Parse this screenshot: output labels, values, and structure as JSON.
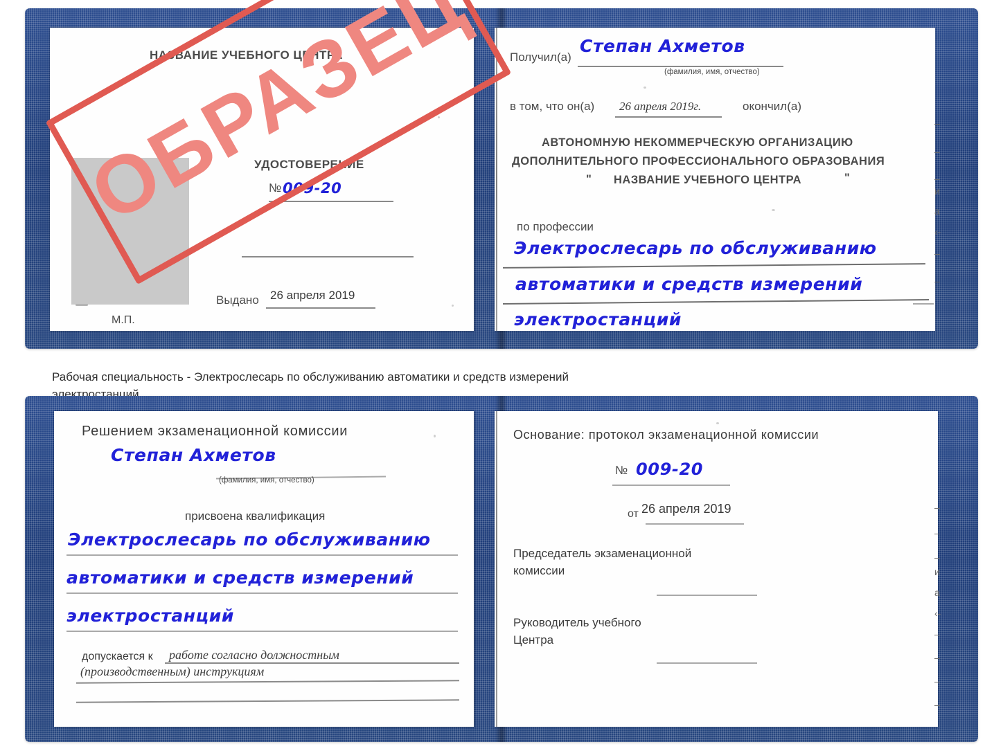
{
  "document": {
    "type": "certificate-scan",
    "colors": {
      "cover_blue": "#254489",
      "handwriting_blue": "#2121d8",
      "stamp_red": "#e05a52",
      "stamp_fill": "#ef8780",
      "print_gray": "#4b4b4b",
      "photo_gray": "#c9c9c9"
    }
  },
  "watermark": {
    "text": "ОБРАЗЕЦ"
  },
  "certificate_1": {
    "left_page": {
      "header": "НАЗВАНИЕ УЧЕБНОГО ЦЕНТРА",
      "doc_type": "УДОСТОВЕРЕНИЕ",
      "number_label": "№",
      "number_value": "009-20",
      "issued_label": "Выдано",
      "issued_value": "26 апреля 2019",
      "stamp_place": "М.П."
    },
    "right_page": {
      "received_label": "Получил(а)",
      "received_value": "Степан Ахметов",
      "fio_hint": "(фамилия, имя, отчество)",
      "in_that_label": "в том, что он(а)",
      "in_that_value": "26 апреля 2019г.",
      "finished_label": "окончил(а)",
      "org_line1": "АВТОНОМНУЮ НЕКОММЕРЧЕСКУЮ ОРГАНИЗАЦИЮ",
      "org_line2": "ДОПОЛНИТЕЛЬНОГО ПРОФЕССИОНАЛЬНОГО ОБРАЗОВАНИЯ",
      "org_quote_open": "\"",
      "org_line3": "НАЗВАНИЕ УЧЕБНОГО ЦЕНТРА",
      "org_quote_close": "\"",
      "profession_label": "по профессии",
      "profession_line1": "Электрослесарь по обслуживанию",
      "profession_line2": "автоматики и средств измерений",
      "profession_line3": "электростанций"
    },
    "margin_marks": [
      "–",
      "–",
      "–",
      "и",
      "а",
      "‹-",
      "–",
      "–"
    ]
  },
  "caption": {
    "line1": "Рабочая специальность - Электрослесарь по обслуживанию автоматики и средств измерений",
    "line2": "электростанций"
  },
  "certificate_2": {
    "left_page": {
      "header": "Решением экзаменационной комиссии",
      "name_value": "Степан Ахметов",
      "fio_hint": "(фамилия, имя, отчество)",
      "qualification_label": "присвоена квалификация",
      "qualification_line1": "Электрослесарь по обслуживанию",
      "qualification_line2": "автоматики и средств измерений",
      "qualification_line3": "электростанций",
      "admitted_label": "допускается к",
      "admitted_value_line1": "работе согласно должностным",
      "admitted_value_line2": "(производственным) инструкциям"
    },
    "right_page": {
      "basis_label": "Основание: протокол экзаменационной комиссии",
      "number_label": "№",
      "number_value": "009-20",
      "date_label": "от",
      "date_value": "26 апреля 2019",
      "chairman_line1": "Председатель экзаменационной",
      "chairman_line2": "комиссии",
      "head_line1": "Руководитель учебного",
      "head_line2": "Центра"
    },
    "margin_marks": [
      "–",
      "–",
      "–",
      "и",
      "а",
      "‹-",
      "–",
      "–",
      "–",
      "–"
    ]
  }
}
